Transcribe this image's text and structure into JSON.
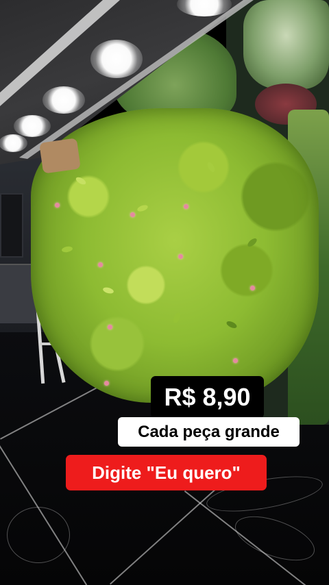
{
  "video": {
    "captions": {
      "price": "R$ 8,90",
      "subtitle": "Cada peça grande",
      "call_to_action": "Digite \"Eu quero\""
    }
  },
  "colors": {
    "price_background": "#000000",
    "price_text": "#ffffff",
    "subtitle_background": "#ffffff",
    "subtitle_text": "#000000",
    "cta_background": "#ee1c1c",
    "cta_text": "#ffffff",
    "foliage": "#8dbb32"
  }
}
